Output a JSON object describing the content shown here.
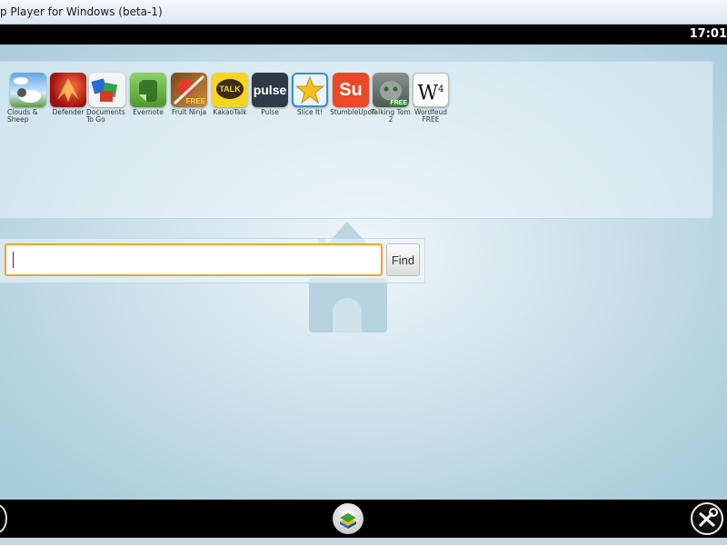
{
  "window": {
    "title": "p Player for Windows (beta-1)"
  },
  "statusbar": {
    "clock": "17:01"
  },
  "apps": [
    {
      "label": "Clouds & Sheep",
      "icon": "clouds-sheep-icon"
    },
    {
      "label": "Defender",
      "icon": "defender-icon"
    },
    {
      "label": "Documents To Go",
      "icon": "documents-to-go-icon"
    },
    {
      "label": "Evernote",
      "icon": "evernote-icon"
    },
    {
      "label": "Fruit Ninja",
      "icon": "fruit-ninja-icon"
    },
    {
      "label": "KakaoTalk",
      "icon": "kakaotalk-icon"
    },
    {
      "label": "Pulse",
      "icon": "pulse-icon"
    },
    {
      "label": "Slice It!",
      "icon": "slice-it-icon"
    },
    {
      "label": "StumbleUpon",
      "icon": "stumbleupon-icon"
    },
    {
      "label": "Talking Tom 2",
      "icon": "talking-tom-icon"
    },
    {
      "label": "Wordfeud FREE",
      "icon": "wordfeud-icon"
    }
  ],
  "icon_text": {
    "kakao": "TALK",
    "fruit_badge": "FREE",
    "tom_badge": "FREE",
    "pulse": "pulse",
    "wordfeud": "W",
    "wordfeud_sup": "4",
    "stumble": "Su"
  },
  "search": {
    "value": "",
    "find_label": "Find"
  },
  "colors": {
    "input_focus": "#f3a22c",
    "statusbar": "#000000",
    "stumbleupon": "#eb4924",
    "kakao": "#f6d521"
  }
}
